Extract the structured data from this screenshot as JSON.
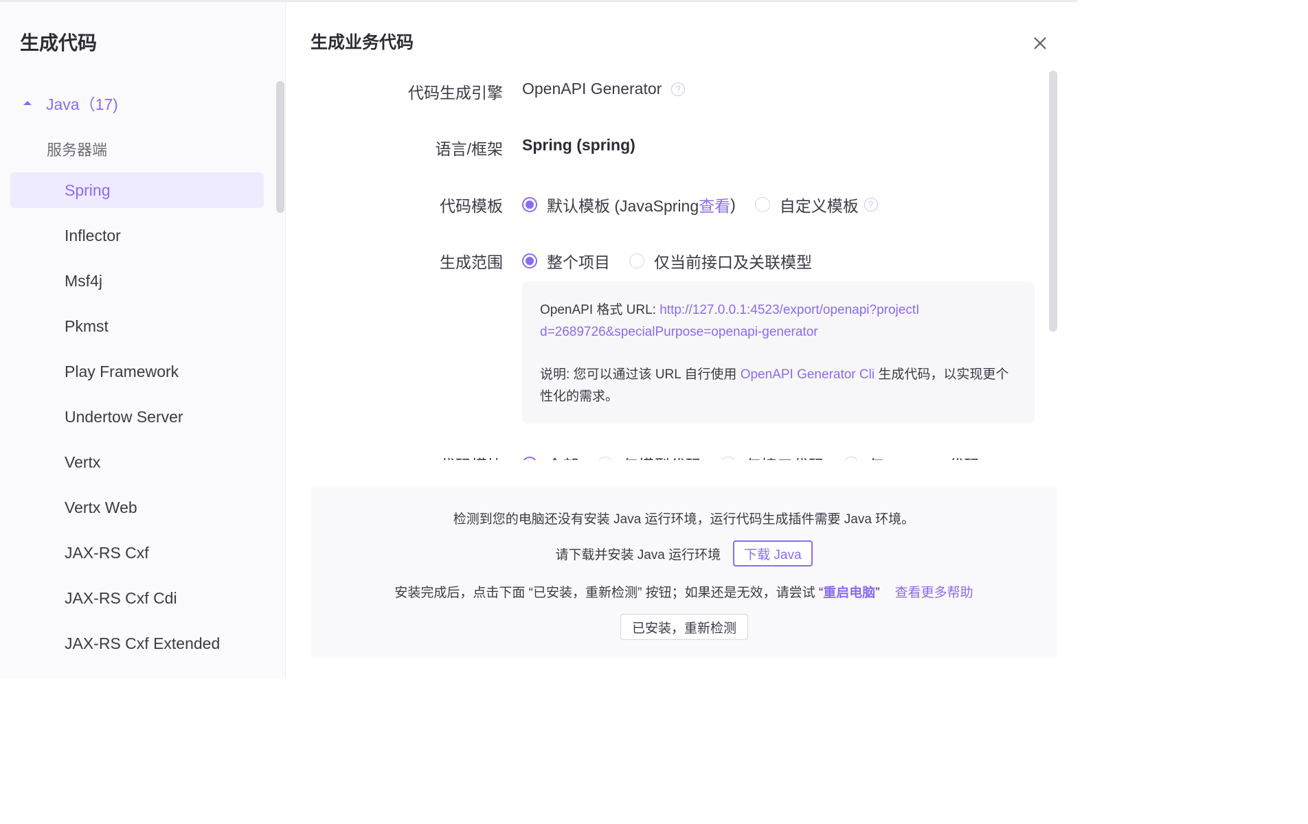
{
  "sidebar": {
    "title": "生成代码",
    "group": {
      "label": "Java（17)",
      "sub_label": "服务器端"
    },
    "items": [
      {
        "label": "Spring",
        "active": true
      },
      {
        "label": "Inflector"
      },
      {
        "label": "Msf4j"
      },
      {
        "label": "Pkmst"
      },
      {
        "label": "Play Framework"
      },
      {
        "label": "Undertow Server"
      },
      {
        "label": "Vertx"
      },
      {
        "label": "Vertx Web"
      },
      {
        "label": "JAX-RS Cxf"
      },
      {
        "label": "JAX-RS Cxf Cdi"
      },
      {
        "label": "JAX-RS Cxf Extended"
      }
    ]
  },
  "main": {
    "title": "生成业务代码",
    "engine": {
      "label": "代码生成引擎",
      "value": "OpenAPI Generator"
    },
    "language": {
      "label": "语言/框架",
      "value": "Spring (spring)"
    },
    "template": {
      "label": "代码模板",
      "default_prefix": "默认模板 (JavaSpring ",
      "view_link": "查看",
      "default_suffix": ")",
      "custom": "自定义模板"
    },
    "scope": {
      "label": "生成范围",
      "whole": "整个项目",
      "current": "仅当前接口及关联模型"
    },
    "info": {
      "url_label": "OpenAPI 格式 URL: ",
      "url": "http://127.0.0.1:4523/export/openapi?projectId=2689726&specialPurpose=openapi-generator",
      "note_prefix": "说明: 您可以通过该 URL 自行使用 ",
      "note_link": "OpenAPI Generator Cli",
      "note_suffix": " 生成代码，以实现更个性化的需求。"
    },
    "module": {
      "label": "代码模块",
      "options": [
        "全部",
        "仅模型代码",
        "仅接口代码",
        "仅 Support 代码"
      ]
    }
  },
  "java_panel": {
    "line1": "检测到您的电脑还没有安装 Java 运行环境，运行代码生成插件需要 Java 环境。",
    "line2": "请下载并安装 Java 运行环境",
    "download_button": "下载 Java",
    "line3_prefix": "安装完成后，点击下面 “已安装，重新检测” 按钮；如果还是无效，请尝试 “",
    "restart": "重启电脑",
    "line3_suffix": "”",
    "more_help": "查看更多帮助",
    "recheck_button": "已安装，重新检测"
  },
  "colors": {
    "accent": "#8b6bf0",
    "active_bg": "#efebfe"
  }
}
